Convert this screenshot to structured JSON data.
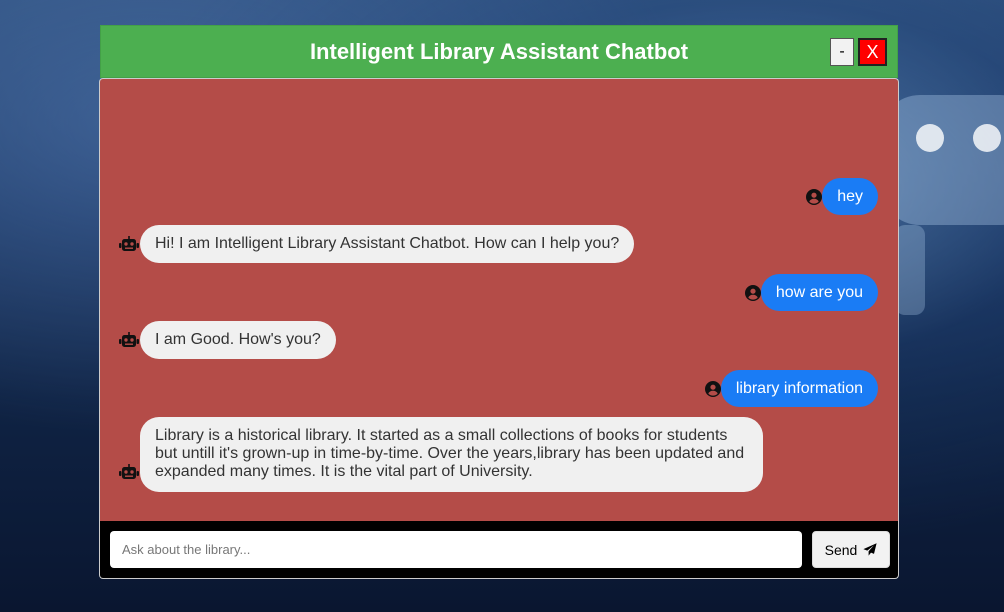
{
  "app": {
    "title": "Intelligent Library Assistant Chatbot"
  },
  "window_controls": {
    "minimize_label": "-",
    "close_label": "X"
  },
  "messages": [
    {
      "from": "user",
      "text": "hey"
    },
    {
      "from": "bot",
      "text": "Hi! I am Intelligent Library Assistant Chatbot. How can I help you?"
    },
    {
      "from": "user",
      "text": "how are you"
    },
    {
      "from": "bot",
      "text": "I am Good. How's you?"
    },
    {
      "from": "user",
      "text": "library information"
    },
    {
      "from": "bot",
      "text": "Library is a historical library. It started as a small collections of books for students but untill it's grown-up in time-by-time. Over the years,library has been updated and expanded many times. It is the vital part of University."
    }
  ],
  "input": {
    "value": "",
    "placeholder": "Ask about the library..."
  },
  "send_button": {
    "label": "Send",
    "icon": "paper-plane-icon"
  },
  "icons": {
    "user": "user-circle-icon",
    "bot": "robot-icon"
  },
  "colors": {
    "header": "#4caf50",
    "chat_bg": "#b44c48",
    "user_bubble": "#1a7cf5",
    "bot_bubble": "#f0f0f0",
    "close_button": "#ff0000",
    "input_bar": "#000000"
  }
}
